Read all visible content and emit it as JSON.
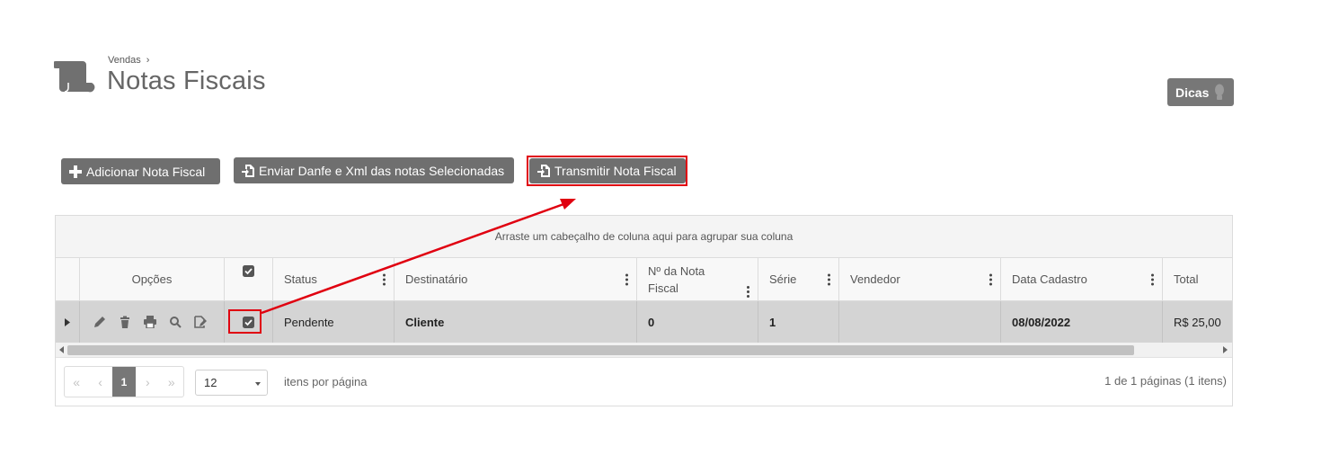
{
  "header": {
    "breadcrumb_parent": "Vendas",
    "breadcrumb_sep": "›",
    "title": "Notas Fiscais",
    "page_icon": "scroll-icon",
    "tips_button": "Dicas",
    "tips_icon": "lightbulb-icon"
  },
  "toolbar": {
    "add_label": "Adicionar Nota Fiscal",
    "add_icon": "plus-icon",
    "send_label": "Enviar Danfe e Xml das notas Selecionadas",
    "send_icon": "file-export-icon",
    "transmit_label": "Transmitir Nota Fiscal",
    "transmit_icon": "file-export-icon"
  },
  "grid": {
    "group_hint": "Arraste um cabeçalho de coluna aqui para agrupar sua coluna",
    "columns": [
      "Opções",
      "",
      "Status",
      "Destinatário",
      "Nº da Nota Fiscal",
      "Série",
      "Vendedor",
      "Data Cadastro",
      "Total"
    ],
    "column_header_nota_line1": "Nº da Nota",
    "column_header_nota_line2": "Fiscal",
    "rows": [
      {
        "status": "Pendente",
        "destinatario": "Cliente",
        "numero": "0",
        "serie": "1",
        "vendedor": "",
        "data_cadastro": "08/08/2022",
        "total": "R$ 25,00",
        "selected": true,
        "actions": [
          "edit-icon",
          "trash-icon",
          "print-icon",
          "search-icon",
          "file-edit-icon"
        ]
      }
    ]
  },
  "pager": {
    "first": "«",
    "prev": "‹",
    "current_page": "1",
    "next": "›",
    "last": "»",
    "page_size": "12",
    "page_size_label": "itens por página",
    "info": "1 de 1 páginas (1 itens)"
  },
  "colors": {
    "button_bg": "#6f6f6f",
    "highlight": "#e00010",
    "row_selected": "#d4d4d4"
  }
}
